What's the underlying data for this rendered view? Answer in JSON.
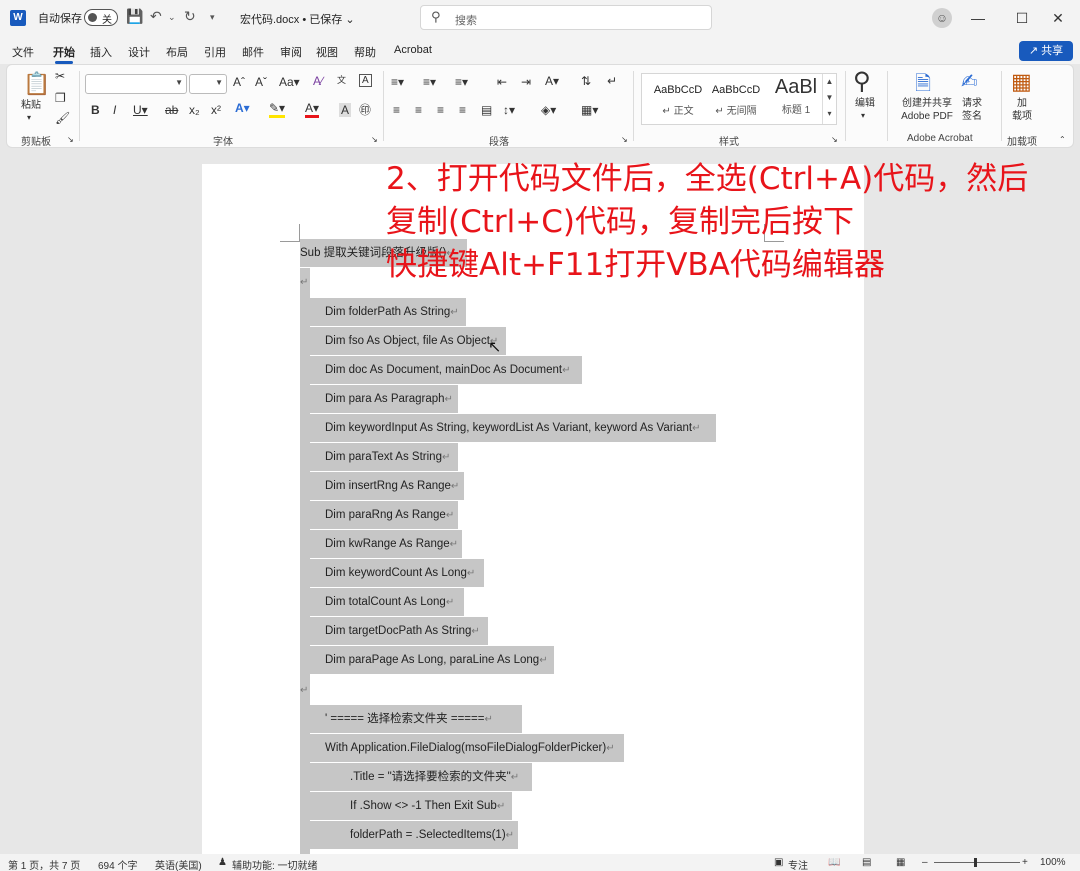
{
  "titlebar": {
    "app_icon": "W",
    "autosave_label": "自动保存",
    "autosave_toggle": "关",
    "doc_title": "宏代码.docx • 已保存",
    "search_placeholder": "搜索"
  },
  "tabs": [
    "文件",
    "开始",
    "插入",
    "设计",
    "布局",
    "引用",
    "邮件",
    "审阅",
    "视图",
    "帮助",
    "Acrobat"
  ],
  "active_tab": "开始",
  "share_label": "共享",
  "ribbon": {
    "paste_label": "粘贴",
    "groups": {
      "clipboard": "剪贴板",
      "font": "字体",
      "paragraph": "段落",
      "styles": "样式",
      "adobe": "Adobe Acrobat",
      "addins": "加载项"
    },
    "styles": [
      {
        "preview": "AaBbCcD",
        "name": "正文"
      },
      {
        "preview": "AaBbCcD",
        "name": "无间隔"
      },
      {
        "preview": "AaBl",
        "name": "标题 1"
      }
    ],
    "edit_label": "编辑",
    "create_pdf_line1": "创建并共享",
    "create_pdf_line2": "Adobe PDF",
    "request_sign_line1": "请求",
    "request_sign_line2": "签名",
    "addin_line1": "加",
    "addin_line2": "载项"
  },
  "annotation": {
    "line1": "2、打开代码文件后，全选(Ctrl+A)代码，然后",
    "line2": "复制(Ctrl+C)代码，复制完后按下",
    "line3": "快捷键Alt+F11打开VBA代码编辑器"
  },
  "code_lines": [
    "Sub  提取关键词段落升级版()",
    "",
    "Dim folderPath As String",
    "Dim fso As Object, file As Object",
    "Dim doc As Document, mainDoc As Document",
    "Dim para As Paragraph",
    "Dim keywordInput As String, keywordList As Variant, keyword As Variant",
    "Dim paraText As String",
    "Dim insertRng As Range",
    "Dim paraRng As Range",
    "Dim kwRange As Range",
    "Dim keywordCount As Long",
    "Dim totalCount As Long",
    "Dim targetDocPath As String",
    "Dim paraPage As Long, paraLine As Long",
    "",
    "' =====  选择检索文件夹  =====",
    "With Application.FileDialog(msoFileDialogFolderPicker)",
    ".Title = \"请选择要检索的文件夹\"",
    "If .Show <> -1 Then Exit Sub",
    "folderPath = .SelectedItems(1)"
  ],
  "paragraph_mark": "↵",
  "statusbar": {
    "page": "第 1 页，共 7 页",
    "words": "694 个字",
    "language": "英语(美国)",
    "accessibility": "辅助功能: 一切就绪",
    "focus": "专注",
    "zoom": "100%"
  }
}
